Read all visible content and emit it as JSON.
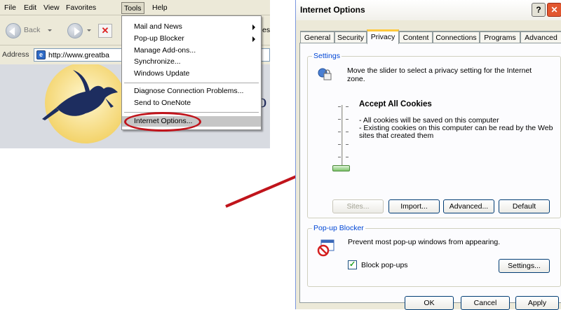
{
  "browser": {
    "menubar": [
      "File",
      "Edit",
      "View",
      "Favorites",
      "Tools",
      "Help"
    ],
    "toolbar": {
      "back_label": "Back"
    },
    "address": {
      "label": "Address",
      "url": "http://www.greatba"
    },
    "toolbar_fragment": "es",
    "page_title_fragment": "Co"
  },
  "tools_menu": {
    "items": [
      {
        "label": "Mail and News",
        "submenu": true
      },
      {
        "label": "Pop-up Blocker",
        "submenu": true
      },
      {
        "label": "Manage Add-ons..."
      },
      {
        "label": "Synchronize..."
      },
      {
        "label": "Windows Update"
      },
      {
        "label": "Diagnose Connection Problems..."
      },
      {
        "label": "Send to OneNote"
      },
      {
        "label": "Internet Options...",
        "highlighted": true
      }
    ]
  },
  "annotation": {
    "highlight_color": "#c0141b",
    "arrow_color": "#c0141b"
  },
  "dialog": {
    "title": "Internet Options",
    "help_glyph": "?",
    "tabs": [
      "General",
      "Security",
      "Privacy",
      "Content",
      "Connections",
      "Programs",
      "Advanced"
    ],
    "selected_tab": "Privacy",
    "settings": {
      "legend": "Settings",
      "description": "Move the slider to select a privacy setting for the Internet zone.",
      "level_title": "Accept All Cookies",
      "level_lines": [
        "- All cookies will be saved on this computer",
        "- Existing cookies on this computer can be read by the Web sites that created them"
      ],
      "slider_position_fraction": 0.0,
      "buttons": {
        "sites": "Sites...",
        "import": "Import...",
        "advanced": "Advanced...",
        "default": "Default"
      }
    },
    "popup_blocker": {
      "legend": "Pop-up Blocker",
      "description": "Prevent most pop-up windows from appearing.",
      "checkbox_label": "Block pop-ups",
      "checked": true,
      "settings_button": "Settings..."
    },
    "footer": {
      "ok": "OK",
      "cancel": "Cancel",
      "apply": "Apply"
    },
    "accent_color": "#ffc83c",
    "legend_color": "#0046d5"
  }
}
